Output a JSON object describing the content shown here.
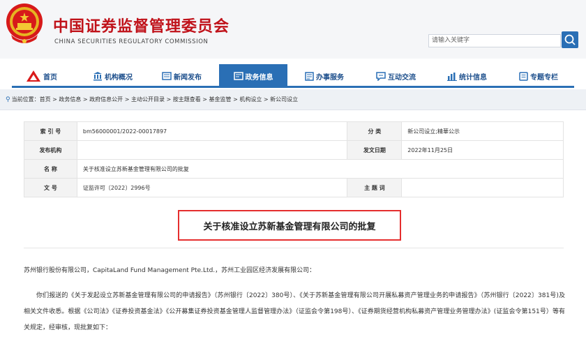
{
  "header": {
    "title_cn": "中国证券监督管理委员会",
    "title_en": "CHINA SECURITIES REGULATORY COMMISSION",
    "search_placeholder": "请输入关键字"
  },
  "nav": {
    "items": [
      {
        "label": "首页",
        "icon": "home-logo-icon"
      },
      {
        "label": "机构概况",
        "icon": "building-icon"
      },
      {
        "label": "新闻发布",
        "icon": "news-icon"
      },
      {
        "label": "政务信息",
        "icon": "gov-info-icon",
        "active": true
      },
      {
        "label": "办事服务",
        "icon": "service-icon"
      },
      {
        "label": "互动交流",
        "icon": "chat-icon"
      },
      {
        "label": "统计信息",
        "icon": "bar-chart-icon"
      },
      {
        "label": "专题专栏",
        "icon": "topic-icon"
      }
    ]
  },
  "breadcrumb": {
    "text": "当前位置：首页 > 政务信息 > 政府信息公开 > 主动公开目录 > 按主题查看 > 基金监管 > 机构设立 > 新公司设立"
  },
  "info_table": {
    "index_label": "索 引 号",
    "index_value": "bm56000001/2022-00017897",
    "category_label": "分 类",
    "category_value": "新公司设立;精華公示",
    "issuer_label": "发布机构",
    "issuer_value": "",
    "date_label": "发文日期",
    "date_value": "2022年11月25日",
    "name_label": "名 称",
    "name_value": "关于核准设立苏新基金管理有限公司的批复",
    "docno_label": "文 号",
    "docno_value": "证监许可〔2022〕2996号",
    "keyword_label": "主 题 词",
    "keyword_value": ""
  },
  "document": {
    "title": "关于核准设立苏新基金管理有限公司的批复",
    "addressee": "苏州银行股份有限公司，CapitaLand Fund Management Pte.Ltd.，苏州工业园区经济发展有限公司：",
    "paragraph": "你们报送的《关于发起设立苏新基金管理有限公司的申请报告》（苏州银行〔2022〕380号）、《关于苏新基金管理有限公司开展私募资产管理业务的申请报告》（苏州银行〔2022〕381号)及相关文件收悉。根据《公司法》《证券投资基金法》《公开募集证券投资基金管理人监督管理办法》（证监会令第198号）、《证券期货经营机构私募资产管理业务管理办法》(证监会令第151号）等有关规定，经审核，现批复如下："
  }
}
